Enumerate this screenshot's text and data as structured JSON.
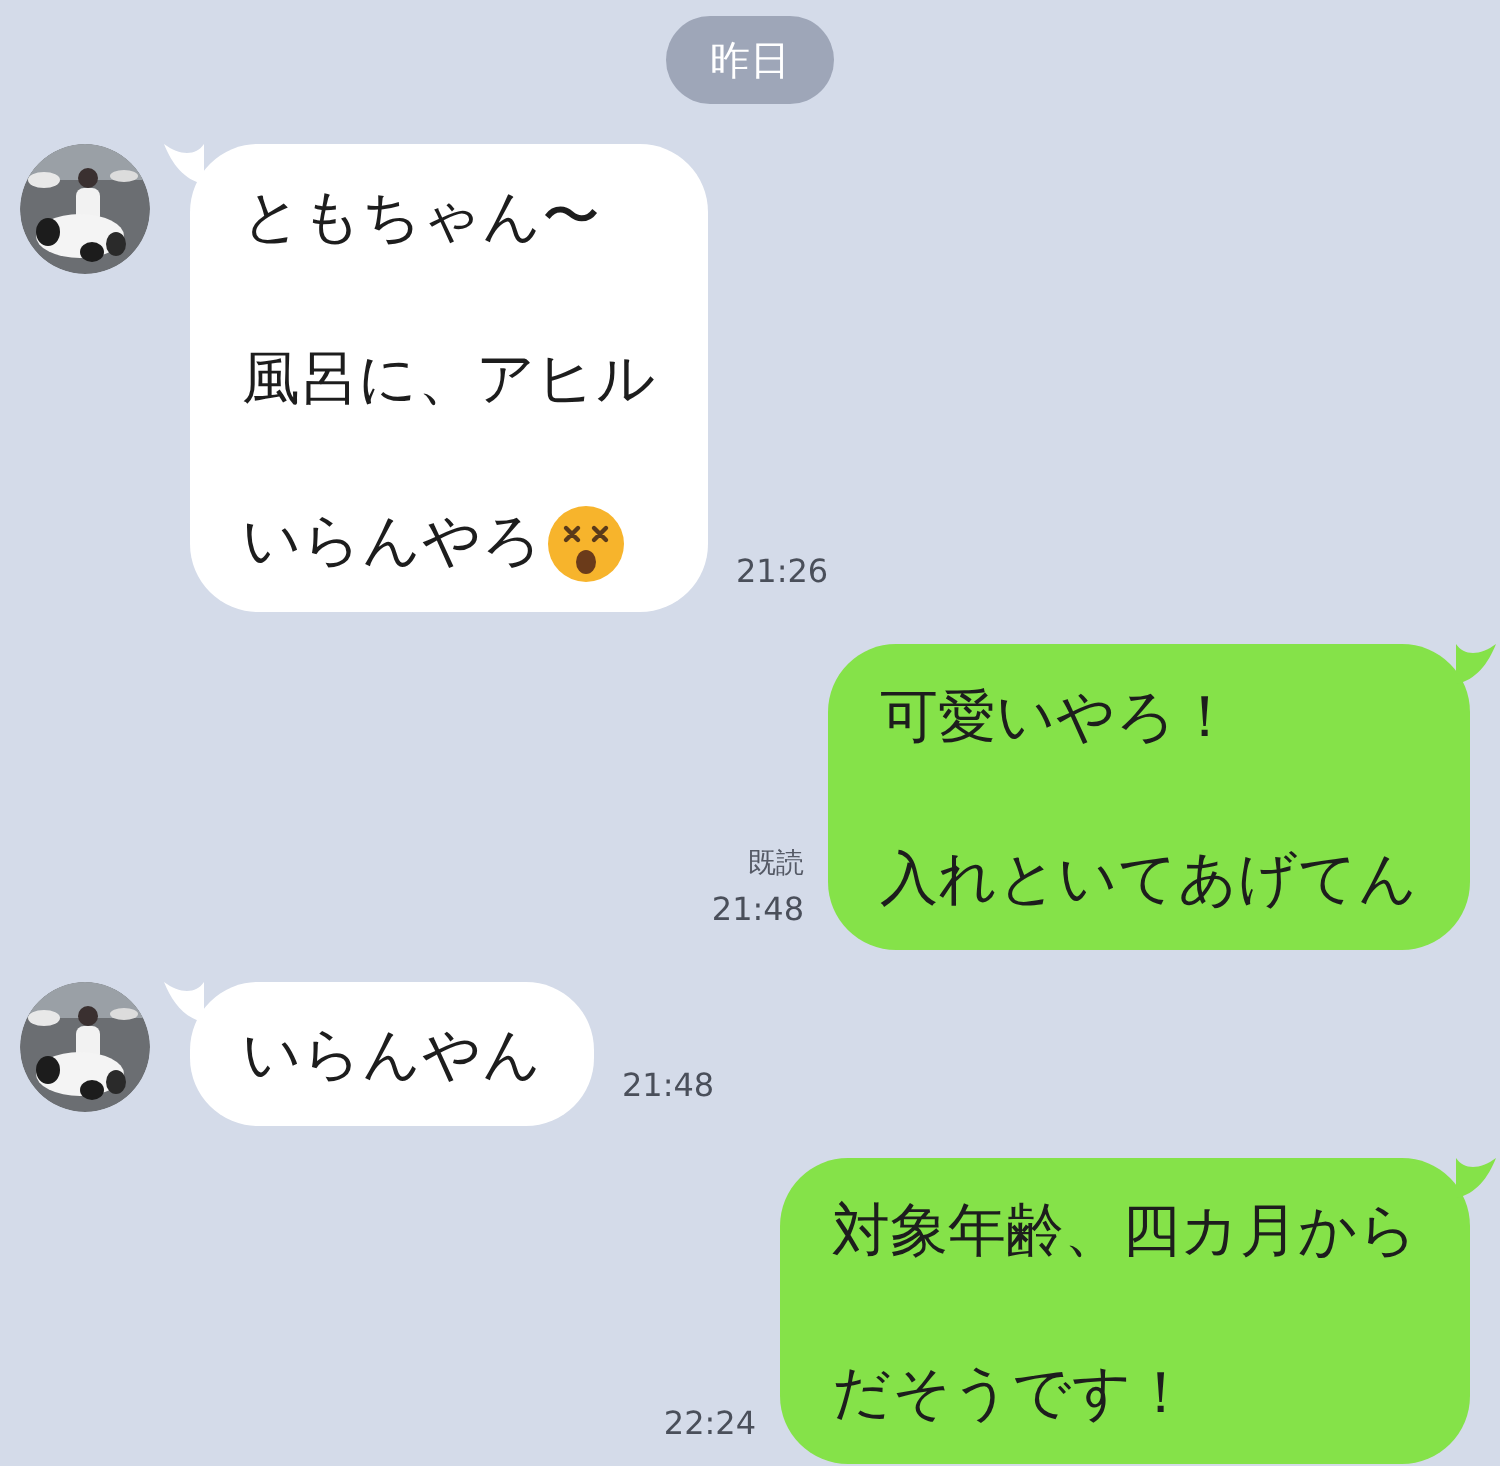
{
  "date_label": "昨日",
  "messages": [
    {
      "kind": "incoming",
      "lines": [
        {
          "text": "ともちゃん〜",
          "emoji": false
        },
        {
          "text": "風呂に、アヒル",
          "emoji": false
        },
        {
          "text": "いらんやろ",
          "emoji": true
        }
      ],
      "time": "21:26"
    },
    {
      "kind": "outgoing",
      "lines": [
        {
          "text": "可愛いやろ！",
          "emoji": false
        },
        {
          "text": "入れといてあげてん",
          "emoji": false
        }
      ],
      "read_label": "既読",
      "time": "21:48"
    },
    {
      "kind": "incoming",
      "lines": [
        {
          "text": "いらんやん",
          "emoji": false
        }
      ],
      "time": "21:48"
    },
    {
      "kind": "outgoing",
      "lines": [
        {
          "text": "対象年齢、四カ月から",
          "emoji": false
        },
        {
          "text": "だそうです！",
          "emoji": false
        }
      ],
      "time": "22:24"
    }
  ]
}
